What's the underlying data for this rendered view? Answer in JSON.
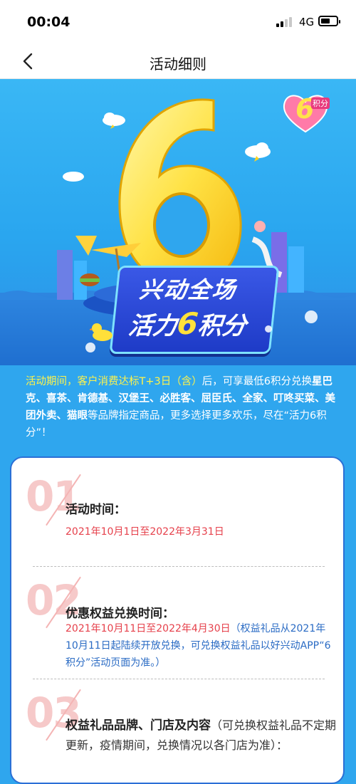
{
  "status_bar": {
    "time": "00:04",
    "network": "4G"
  },
  "nav": {
    "title": "活动细则"
  },
  "hero": {
    "banner_line1": "兴动全场",
    "banner_line2_a": "活力",
    "banner_line2_num": "6",
    "banner_line2_b": "积分",
    "badge_num": "6",
    "badge_text": "积分"
  },
  "intro": {
    "highlight": "活动期间，客户消费达标T+3日（含）",
    "text1": "后，可享最低6积分兑换",
    "brands": "星巴克、喜茶、肯德基、汉堡王、必胜客、屈臣氏、全家、叮咚买菜、美团外卖、猫眼",
    "text2": "等品牌指定商品，更多选择更多欢乐，尽在“活力6积分”！"
  },
  "sections": [
    {
      "num": "01",
      "title": "活动时间：",
      "body_red": "2021年10月1日至2022年3月31日"
    },
    {
      "num": "02",
      "title": "优惠权益兑换时间：",
      "body_red": "2021年10月11日至2022年4月30日",
      "body_blue": "（权益礼品从2021年10月11日起陆续开放兑换，可兑换权益礼品以好兴动APP“6积分”活动页面为准。）"
    },
    {
      "num": "03",
      "title": "权益礼品品牌、门店及内容",
      "note": "（可兑换权益礼品不定期更新，疫情期间，兑换情况以各门店为准）："
    }
  ],
  "colors": {
    "accent_blue": "#2b6fd6",
    "hero_sky": "#3ab7f5",
    "highlight_yellow": "#fff34a",
    "red_text": "#e6404b"
  }
}
